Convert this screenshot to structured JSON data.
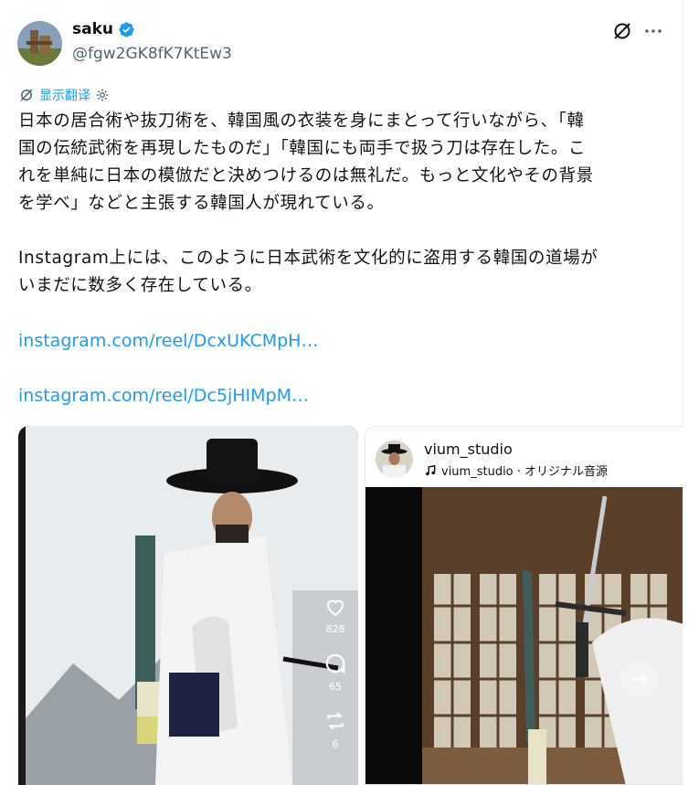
{
  "author": {
    "name": "saku",
    "handle": "@fgw2GK8fK7KtEw3"
  },
  "translate": {
    "label": "显示翻译"
  },
  "post": {
    "line1": "日本の居合術や抜刀術を、韓国風の衣装を身にまとって行いながら、「韓",
    "line2": "国の伝統武術を再現したものだ」「韓国にも両手で扱う刀は存在した。こ",
    "line3": "れを単純に日本の模倣だと決めつけるのは無礼だ。もっと文化やその背景",
    "line4": "を学べ」などと主張する韓国人が現れている。",
    "line5": "Instagram上には、このように日本武術を文化的に盗用する韓国の道場が",
    "line6": "いまだに数多く存在している。",
    "link1": "instagram.com/reel/DcxUKCMpH…",
    "link2": "instagram.com/reel/Dc5jHIMpM…"
  },
  "media1": {
    "likes": "828",
    "comments": "65",
    "reposts": "6"
  },
  "media2": {
    "username": "vium_studio",
    "audio": "vium_studio · オリジナル音源"
  },
  "colors": {
    "accent": "#1d9bf0",
    "text": "#0f1419",
    "secondary": "#536471"
  }
}
